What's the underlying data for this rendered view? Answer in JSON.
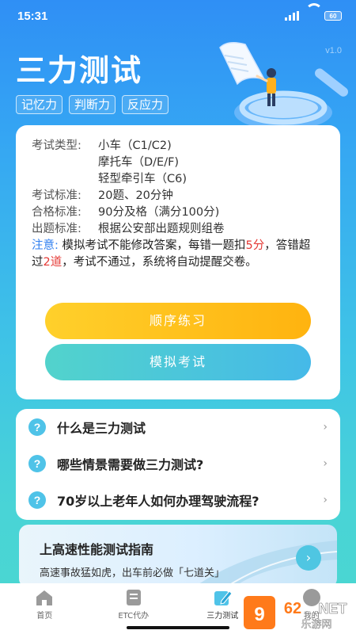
{
  "status_bar": {
    "time": "15:31",
    "battery": "60"
  },
  "header": {
    "title": "三力测试",
    "version": "v1.0",
    "tags": [
      "记忆力",
      "判断力",
      "反应力"
    ]
  },
  "info": {
    "rows": [
      {
        "label": "考试类型:",
        "values": [
          "小车（C1/C2)",
          "摩托车（D/E/F)",
          "轻型牵引车（C6)"
        ]
      },
      {
        "label": "考试标准:",
        "values": [
          "20题、20分钟"
        ]
      },
      {
        "label": "合格标准:",
        "values": [
          "90分及格（满分100分)"
        ]
      },
      {
        "label": "出题标准:",
        "values": [
          "根据公安部出题规则组卷"
        ]
      }
    ],
    "notice": {
      "lead": "注意:",
      "part1": " 模拟考试不能修改答案，每错一题扣",
      "deduct": "5分",
      "part2": "，答错超过",
      "limit": "2道",
      "part3": "，考试不通过，系统将自动提醒交卷。"
    },
    "buttons": {
      "order": "顺序练习",
      "exam": "模拟考试"
    }
  },
  "faq": [
    "什么是三力测试",
    "哪些情景需要做三力测试?",
    "70岁以上老年人如何办理驾驶流程?"
  ],
  "article": {
    "title": "上高速性能测试指南",
    "desc": "高速事故猛如虎，出车前必做「七道关」"
  },
  "tabs": [
    "首页",
    "ETC代办",
    "三力测试",
    "我的"
  ],
  "colors": {
    "accent_yellow": "#ffc21a",
    "accent_teal": "#4cc9d8",
    "notice_blue": "#2f7ff0",
    "notice_red": "#e53935"
  }
}
